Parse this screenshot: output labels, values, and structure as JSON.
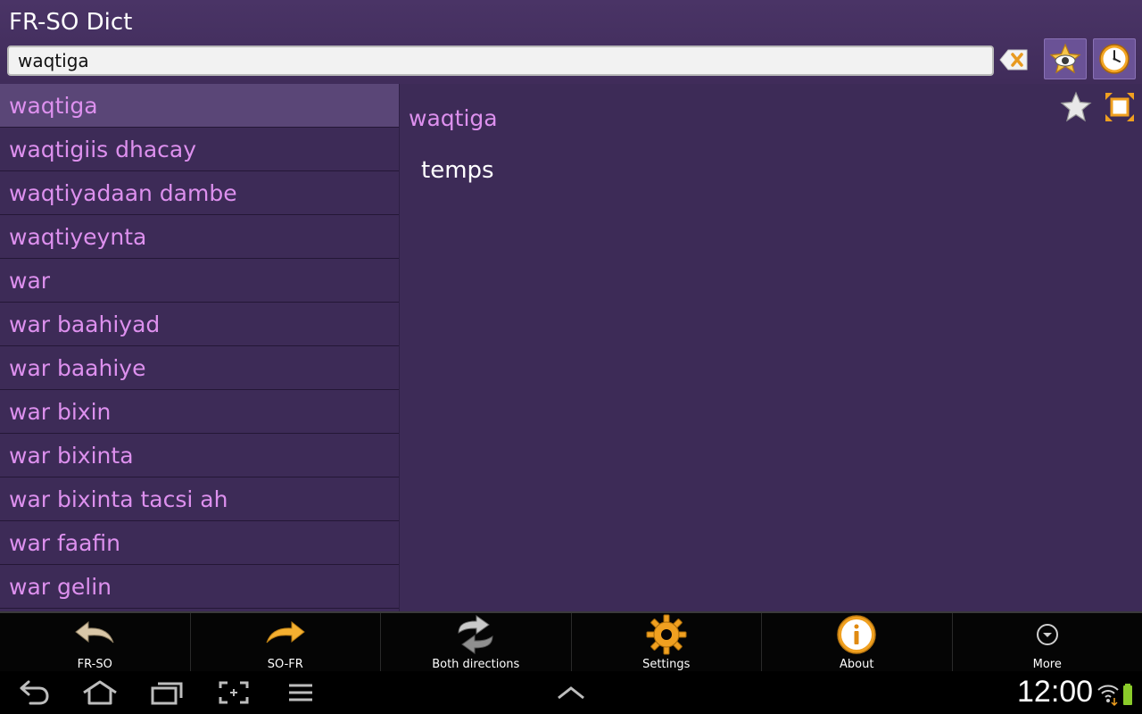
{
  "app": {
    "title": "FR-SO Dict"
  },
  "search": {
    "value": "waqtiga",
    "clear_icon": "clear-text-icon"
  },
  "toolbar": {
    "favorites_icon": "favorites-eye-icon",
    "history_icon": "history-clock-icon"
  },
  "word_list": {
    "selected_index": 0,
    "items": [
      "waqtiga",
      "waqtigiis dhacay",
      "waqtiyadaan dambe",
      "waqtiyeynta",
      "war",
      "war baahiyad",
      "war baahiye",
      "war bixin",
      "war bixinta",
      "war bixinta tacsi ah",
      "war faafin",
      "war gelin"
    ]
  },
  "detail": {
    "word": "waqtiga",
    "translation": "temps",
    "star_icon": "star-icon",
    "fullscreen_icon": "fullscreen-icon"
  },
  "actions": [
    {
      "label": "FR-SO",
      "icon": "arrow-left-icon"
    },
    {
      "label": "SO-FR",
      "icon": "arrow-right-icon"
    },
    {
      "label": "Both directions",
      "icon": "swap-arrows-icon"
    },
    {
      "label": "Settings",
      "icon": "gear-icon"
    },
    {
      "label": "About",
      "icon": "info-icon"
    },
    {
      "label": "More",
      "icon": "chevron-down-icon"
    }
  ],
  "system": {
    "time": "12:00"
  },
  "colors": {
    "background": "#3d2b57",
    "selected_row": "#5a4677",
    "word_text": "#dd90ee",
    "accent_orange": "#f0a020"
  }
}
